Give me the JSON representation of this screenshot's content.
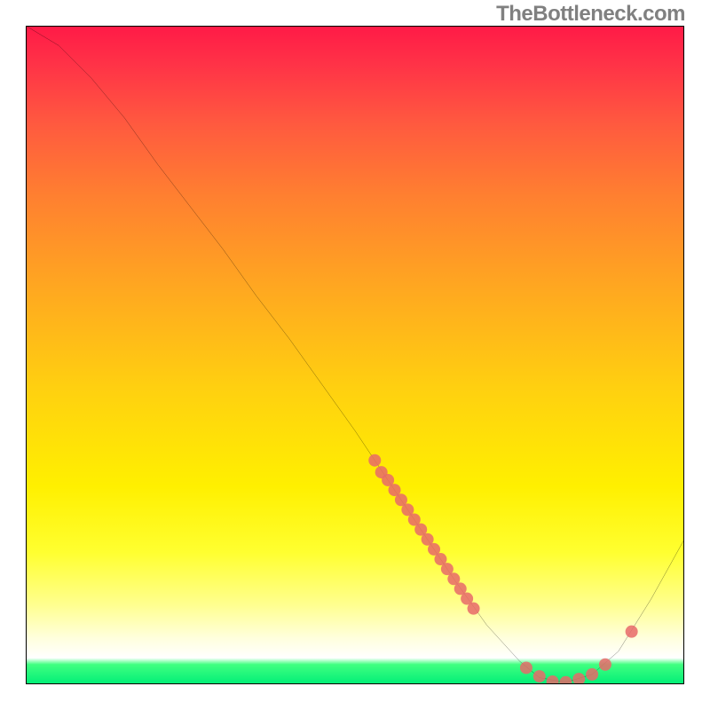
{
  "attribution": "TheBottleneck.com",
  "chart_data": {
    "type": "line",
    "title": "",
    "xlabel": "",
    "ylabel": "",
    "xlim": [
      0,
      100
    ],
    "ylim": [
      0,
      100
    ],
    "curve": {
      "name": "bottleneck-curve",
      "color": "#000000",
      "points": [
        {
          "x": 0.0,
          "y": 100.0
        },
        {
          "x": 5.0,
          "y": 97.0
        },
        {
          "x": 10.0,
          "y": 92.0
        },
        {
          "x": 15.0,
          "y": 86.0
        },
        {
          "x": 20.0,
          "y": 79.0
        },
        {
          "x": 25.0,
          "y": 72.5
        },
        {
          "x": 30.0,
          "y": 66.0
        },
        {
          "x": 35.0,
          "y": 59.0
        },
        {
          "x": 40.0,
          "y": 52.5
        },
        {
          "x": 45.0,
          "y": 45.5
        },
        {
          "x": 50.0,
          "y": 38.5
        },
        {
          "x": 55.0,
          "y": 31.0
        },
        {
          "x": 60.0,
          "y": 23.5
        },
        {
          "x": 65.0,
          "y": 16.0
        },
        {
          "x": 70.0,
          "y": 9.0
        },
        {
          "x": 75.0,
          "y": 3.5
        },
        {
          "x": 78.0,
          "y": 1.0
        },
        {
          "x": 82.0,
          "y": 0.3
        },
        {
          "x": 86.0,
          "y": 1.5
        },
        {
          "x": 90.0,
          "y": 5.0
        },
        {
          "x": 95.0,
          "y": 13.0
        },
        {
          "x": 100.0,
          "y": 22.0
        }
      ]
    },
    "scatter_points": {
      "color": "#e86a6a",
      "radius": 7,
      "points": [
        {
          "x": 53,
          "y": 34.0
        },
        {
          "x": 54,
          "y": 32.2
        },
        {
          "x": 55,
          "y": 31.0
        },
        {
          "x": 56,
          "y": 29.5
        },
        {
          "x": 57,
          "y": 28.0
        },
        {
          "x": 58,
          "y": 26.5
        },
        {
          "x": 59,
          "y": 25.0
        },
        {
          "x": 60,
          "y": 23.5
        },
        {
          "x": 61,
          "y": 22.0
        },
        {
          "x": 62,
          "y": 20.5
        },
        {
          "x": 63,
          "y": 19.0
        },
        {
          "x": 64,
          "y": 17.5
        },
        {
          "x": 65,
          "y": 16.0
        },
        {
          "x": 66,
          "y": 14.5
        },
        {
          "x": 67,
          "y": 13.0
        },
        {
          "x": 68,
          "y": 11.5
        },
        {
          "x": 76,
          "y": 2.5
        },
        {
          "x": 78,
          "y": 1.2
        },
        {
          "x": 80,
          "y": 0.4
        },
        {
          "x": 82,
          "y": 0.3
        },
        {
          "x": 84,
          "y": 0.8
        },
        {
          "x": 86,
          "y": 1.5
        },
        {
          "x": 88,
          "y": 3.0
        },
        {
          "x": 92,
          "y": 8.0
        }
      ]
    }
  }
}
